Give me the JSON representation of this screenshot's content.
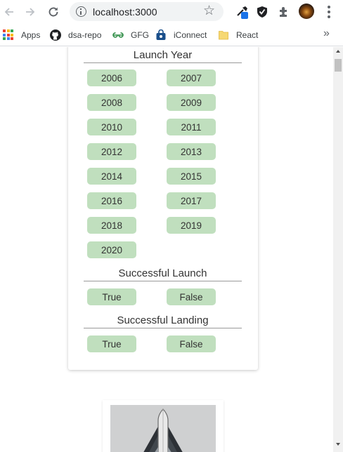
{
  "browser": {
    "url": "localhost:3000",
    "bookmarks": [
      {
        "label": "Apps",
        "icon": "apps-grid-icon"
      },
      {
        "label": "dsa-repo",
        "icon": "github-icon"
      },
      {
        "label": "GFG",
        "icon": "gfg-icon"
      },
      {
        "label": "iConnect",
        "icon": "lock-bag-icon"
      },
      {
        "label": "React",
        "icon": "folder-icon"
      }
    ]
  },
  "filters": {
    "launch_year": {
      "title": "Launch Year",
      "years": [
        "2006",
        "2007",
        "2008",
        "2009",
        "2010",
        "2011",
        "2012",
        "2013",
        "2014",
        "2015",
        "2016",
        "2017",
        "2018",
        "2019",
        "2020"
      ]
    },
    "successful_launch": {
      "title": "Successful Launch",
      "options": [
        "True",
        "False"
      ]
    },
    "successful_landing": {
      "title": "Successful Landing",
      "options": [
        "True",
        "False"
      ]
    }
  },
  "colors": {
    "filter_button_bg": "#c0dfbe",
    "apps_icon": [
      "#ea4335",
      "#fbbc05",
      "#34a853",
      "#4285f4",
      "#ea4335",
      "#fbbc05",
      "#34a853",
      "#4285f4",
      "#ea4335"
    ]
  }
}
